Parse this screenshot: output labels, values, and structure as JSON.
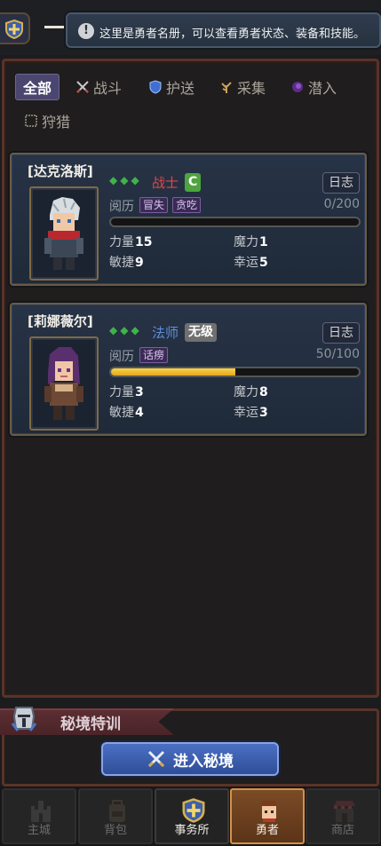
{
  "tip": {
    "icon": "exclamation-icon",
    "text": "这里是勇者名册，可以查看勇者状态、装备和技能。"
  },
  "tabs": [
    {
      "label": "全部",
      "icon": ""
    },
    {
      "label": "战斗",
      "icon": "crossed-swords-icon"
    },
    {
      "label": "护送",
      "icon": "shield-icon"
    },
    {
      "label": "采集",
      "icon": "herb-icon"
    },
    {
      "label": "潜入",
      "icon": "shadow-icon"
    },
    {
      "label": "狩猎",
      "icon": "trap-icon"
    }
  ],
  "heroes": [
    {
      "name": "[达克洛斯]",
      "stars": "◆◆◆",
      "class": "战士",
      "class_color": "#e0484a",
      "grade": "C",
      "grade_color": "#4ea53f",
      "log": "日志",
      "exp_label": "阅历",
      "traits": [
        "冒失",
        "贪吃"
      ],
      "exp": "0/200",
      "exp_fraction": 0,
      "stats": {
        "str_label": "力量",
        "str": "15",
        "mag_label": "魔力",
        "mag": "1",
        "agi_label": "敏捷",
        "agi": "9",
        "luck_label": "幸运",
        "luck": "5"
      }
    },
    {
      "name": "[莉娜薇尔]",
      "stars": "◆◆◆",
      "class": "法师",
      "class_color": "#5f8ed8",
      "grade": "无级",
      "grade_color": "#6f6f6f",
      "log": "日志",
      "exp_label": "阅历",
      "traits": [
        "话痨"
      ],
      "exp": "50/100",
      "exp_fraction": 0.5,
      "stats": {
        "str_label": "力量",
        "str": "3",
        "mag_label": "魔力",
        "mag": "8",
        "agi_label": "敏捷",
        "agi": "4",
        "luck_label": "幸运",
        "luck": "3"
      }
    }
  ],
  "realm": {
    "title": "秘境特训",
    "button": "进入秘境"
  },
  "nav": [
    {
      "label": "主城",
      "icon": "castle-icon"
    },
    {
      "label": "背包",
      "icon": "backpack-icon"
    },
    {
      "label": "事务所",
      "icon": "guild-shield-icon"
    },
    {
      "label": "勇者",
      "icon": "hero-face-icon"
    },
    {
      "label": "商店",
      "icon": "shop-icon"
    }
  ]
}
